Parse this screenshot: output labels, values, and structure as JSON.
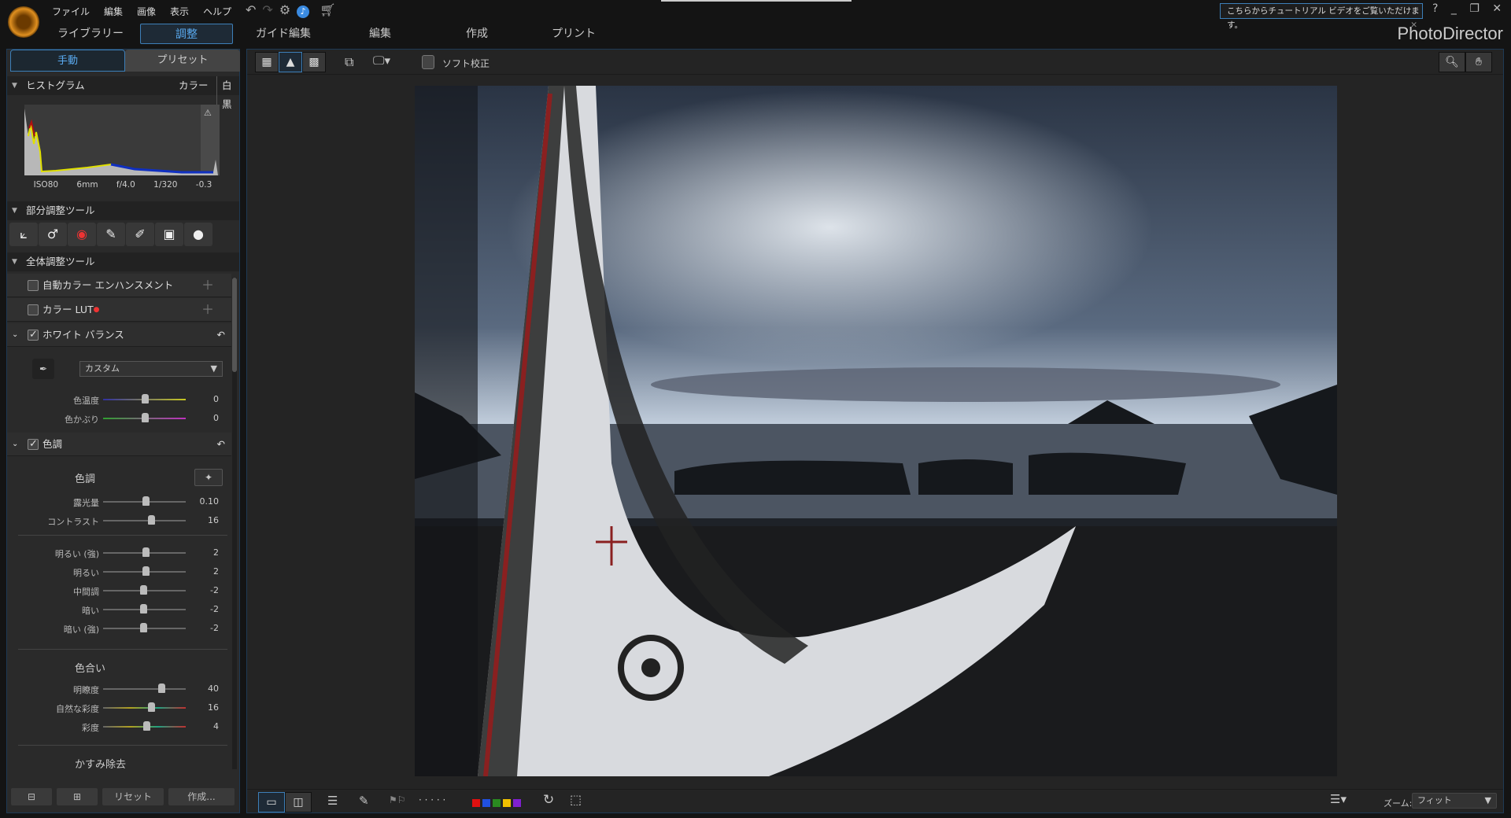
{
  "menu": [
    "ファイル",
    "編集",
    "画像",
    "表示",
    "ヘルプ"
  ],
  "modules": {
    "tabs": [
      "ライブラリー",
      "調整",
      "ガイド編集",
      "編集",
      "作成",
      "プリント"
    ],
    "active": "調整"
  },
  "notification": {
    "text": "こちらからチュートリアル ビデオをご覧いただけます。",
    "close": "✕"
  },
  "window": {
    "help": "?",
    "minimize": "_",
    "restore": "❐",
    "close": "✕"
  },
  "app_title": "PhotoDirector",
  "panel_tabs": {
    "manual": "手動",
    "preset": "プリセット"
  },
  "histogram": {
    "title": "ヒストグラム",
    "color": "カラー",
    "bw": "白黒",
    "exif": [
      "ISO80",
      "6mm",
      "f/4.0",
      "1/320",
      "-0.3"
    ]
  },
  "regional": {
    "title": "部分調整ツール"
  },
  "global": {
    "title": "全体調整ツール",
    "auto_color": "自動カラー エンハンスメント",
    "lut": "カラー LUT",
    "wb": {
      "title": "ホワイト バランス",
      "preset": "カスタム",
      "sliders": [
        {
          "label": "色温度",
          "value": "0"
        },
        {
          "label": "色かぶり",
          "value": "0"
        }
      ]
    },
    "tone": {
      "title": "色調",
      "sub": "色調",
      "sliders": [
        {
          "label": "露光量",
          "value": "0.10"
        },
        {
          "label": "コントラスト",
          "value": "16"
        }
      ],
      "tones": [
        {
          "label": "明るい (強)",
          "value": "2"
        },
        {
          "label": "明るい",
          "value": "2"
        },
        {
          "label": "中間調",
          "value": "-2"
        },
        {
          "label": "暗い",
          "value": "-2"
        },
        {
          "label": "暗い (強)",
          "value": "-2"
        }
      ],
      "hue_title": "色合い",
      "hue": [
        {
          "label": "明瞭度",
          "value": "40"
        },
        {
          "label": "自然な彩度",
          "value": "16"
        },
        {
          "label": "彩度",
          "value": "4"
        }
      ],
      "dehaze": "かすみ除去"
    }
  },
  "bottom_buttons": {
    "reset": "リセット",
    "create": "作成..."
  },
  "toolbar": {
    "soft_proof": "ソフト校正"
  },
  "statusbar": {
    "zoom_label": "ズーム:",
    "zoom_value": "フィット",
    "colors": [
      "#e01010",
      "#2050e0",
      "#2a8a20",
      "#f0c000",
      "#8020d0"
    ],
    "rating": "· · · · ·"
  },
  "colors": {
    "accent": "#3d7fb8"
  }
}
